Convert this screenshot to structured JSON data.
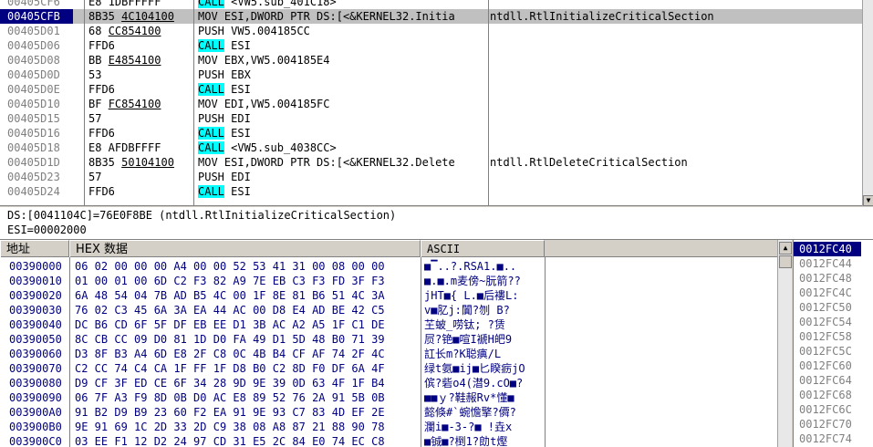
{
  "disasm": {
    "rows": [
      {
        "addr": "00405CF6",
        "hex": "E8 1DBFFFFF",
        "hex_ul": "",
        "instr_kw": "CALL",
        "instr": " <VW5.sub_401C18>",
        "comment": "",
        "selected": false
      },
      {
        "addr": "00405CFB",
        "hex": "8B35 ",
        "hex_ul": "4C104100",
        "instr_kw": "",
        "instr": "MOV ESI,DWORD PTR DS:[<&KERNEL32.Initia",
        "comment": "ntdll.RtlInitializeCriticalSection",
        "selected": true
      },
      {
        "addr": "00405D01",
        "hex": "68 ",
        "hex_ul": "CC854100",
        "instr_kw": "",
        "instr": "PUSH VW5.004185CC",
        "comment": "",
        "selected": false
      },
      {
        "addr": "00405D06",
        "hex": "FFD6",
        "hex_ul": "",
        "instr_kw": "CALL",
        "instr": " ESI",
        "comment": "",
        "selected": false
      },
      {
        "addr": "00405D08",
        "hex": "BB ",
        "hex_ul": "E4854100",
        "instr_kw": "",
        "instr": "MOV EBX,VW5.004185E4",
        "comment": "",
        "selected": false
      },
      {
        "addr": "00405D0D",
        "hex": "53",
        "hex_ul": "",
        "instr_kw": "",
        "instr": "PUSH EBX",
        "comment": "",
        "selected": false
      },
      {
        "addr": "00405D0E",
        "hex": "FFD6",
        "hex_ul": "",
        "instr_kw": "CALL",
        "instr": " ESI",
        "comment": "",
        "selected": false
      },
      {
        "addr": "00405D10",
        "hex": "BF ",
        "hex_ul": "FC854100",
        "instr_kw": "",
        "instr": "MOV EDI,VW5.004185FC",
        "comment": "",
        "selected": false
      },
      {
        "addr": "00405D15",
        "hex": "57",
        "hex_ul": "",
        "instr_kw": "",
        "instr": "PUSH EDI",
        "comment": "",
        "selected": false
      },
      {
        "addr": "00405D16",
        "hex": "FFD6",
        "hex_ul": "",
        "instr_kw": "CALL",
        "instr": " ESI",
        "comment": "",
        "selected": false
      },
      {
        "addr": "00405D18",
        "hex": "E8 AFDBFFFF",
        "hex_ul": "",
        "instr_kw": "CALL",
        "instr": " <VW5.sub_4038CC>",
        "comment": "",
        "selected": false
      },
      {
        "addr": "00405D1D",
        "hex": "8B35 ",
        "hex_ul": "50104100",
        "instr_kw": "",
        "instr": "MOV ESI,DWORD PTR DS:[<&KERNEL32.Delete",
        "comment": "ntdll.RtlDeleteCriticalSection",
        "selected": false
      },
      {
        "addr": "00405D23",
        "hex": "57",
        "hex_ul": "",
        "instr_kw": "",
        "instr": "PUSH EDI",
        "comment": "",
        "selected": false
      },
      {
        "addr": "00405D24",
        "hex": "FFD6",
        "hex_ul": "",
        "instr_kw": "CALL",
        "instr": " ESI",
        "comment": "",
        "selected": false
      }
    ]
  },
  "info": {
    "line1": "DS:[0041104C]=76E0F8BE (ntdll.RtlInitializeCriticalSection)",
    "line2": "ESI=00002000"
  },
  "dump": {
    "headers": {
      "address": "地址",
      "hex": "HEX 数据",
      "ascii": "ASCII"
    },
    "rows": [
      {
        "addr": "00390000",
        "hex": "06 02 00 00 00 A4 00 00 52 53 41 31 00 08 00 00",
        "ascii": "■▔..?.RSA1.■.."
      },
      {
        "addr": "00390010",
        "hex": "01 00 01 00 6D C2 F3 82 A9 7E EB C3 F3 FD 3F F3",
        "ascii": "■.■.m麦傍~朊箭??"
      },
      {
        "addr": "00390020",
        "hex": "6A 48 54 04 7B AD B5 4C 00 1F 8E 81 B6 51 4C 3A",
        "ascii": "jHT■{ L.■后褸L:"
      },
      {
        "addr": "00390030",
        "hex": "76 02 C3 45 6A 3A EA 44 AC 00 D8 E4 AD BE 42 C5",
        "ascii": "v■肊j:闐?刎 B?"
      },
      {
        "addr": "00390040",
        "hex": "DC B6 CD 6F 5F DF EB EE D1 3B AC A2 A5 1F C1 DE",
        "ascii": "芏蚾_唠钛; ?赁"
      },
      {
        "addr": "00390050",
        "hex": "8C CB CC 09 D0 81 1D D0 FA 49 D1 5D 48 B0 71 39",
        "ascii": "屃?铯■喧I褫H皅9"
      },
      {
        "addr": "00390060",
        "hex": "D3 8F B3 A4 6D E8 2F C8 0C 4B B4 CF AF 74 2F 4C",
        "ascii": "訌长m?K聪痶/L"
      },
      {
        "addr": "00390070",
        "hex": "C2 CC 74 C4 CA 1F FF 1F D8 B0 C2 8D F0 DF 6A 4F",
        "ascii": "绿t氨■ij■匕睽疬jO"
      },
      {
        "addr": "00390080",
        "hex": "D9 CF 3F ED CE 6F 34 28 9D 9E 39 0D 63 4F 1F B4",
        "ascii": "傧?砦o4(澘9.cO■?"
      },
      {
        "addr": "00390090",
        "hex": "06 7F A3 F9 8D 0B D0 AC E8 89 52 76 2A 91 5B 0B",
        "ascii": "■■ｙ?鞋赧Rv*懂■"
      },
      {
        "addr": "003900A0",
        "hex": "91 B2 D9 B9 23 60 F2 EA 91 9E 93 C7 83 4D EF 2E",
        "ascii": "懿倏#`蜿憺擎?僲?"
      },
      {
        "addr": "003900B0",
        "hex": "9E 91 69 1C 2D 33 2D C9 38 08 A8 87 21 88 90 78",
        "ascii": "瀾i■-3-?■ !垚x"
      },
      {
        "addr": "003900C0",
        "hex": "03 EE F1 12 D2 24 97 CD 31 E5 2C 84 E0 74 EC C8",
        "ascii": "■铖■?椡1?勆t熞"
      }
    ]
  },
  "stack": {
    "rows": [
      "0012FC40",
      "0012FC44",
      "0012FC48",
      "0012FC4C",
      "0012FC50",
      "0012FC54",
      "0012FC58",
      "0012FC5C",
      "0012FC60",
      "0012FC64",
      "0012FC68",
      "0012FC6C",
      "0012FC70",
      "0012FC74"
    ]
  },
  "colors": {
    "selection": "#000080",
    "call_highlight": "#00ffff",
    "row_selected": "#c0c0c0"
  }
}
